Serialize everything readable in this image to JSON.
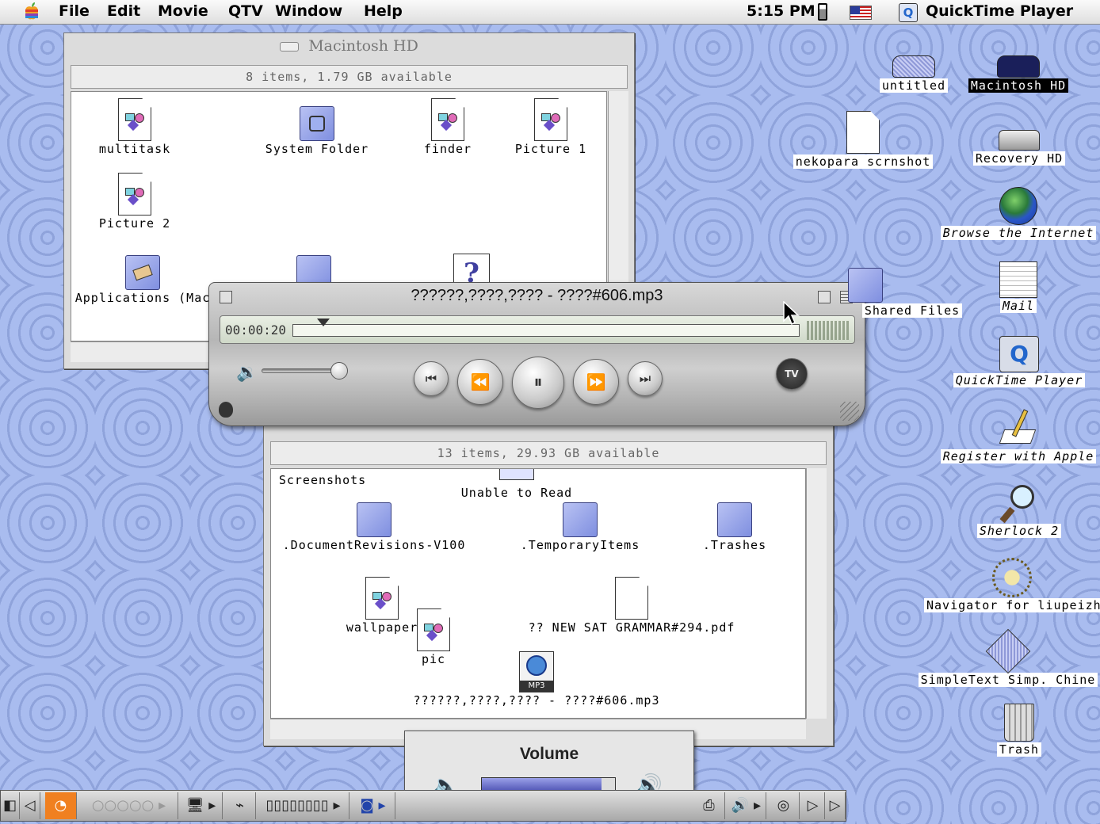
{
  "menubar": {
    "items": [
      "File",
      "Edit",
      "Movie",
      "QTV",
      "Window",
      "Help"
    ],
    "clock": "5:15 PM",
    "app_name": "QuickTime Player",
    "apple_icon": "apple-logo"
  },
  "macintosh_hd_window": {
    "title": "Macintosh HD",
    "info": "8 items, 1.79 GB available",
    "items": [
      {
        "label": "multitask",
        "icon": "picture-doc"
      },
      {
        "label": "System Folder",
        "icon": "system-folder"
      },
      {
        "label": "finder",
        "icon": "picture-doc"
      },
      {
        "label": "Picture 1",
        "icon": "picture-doc"
      },
      {
        "label": "Picture 2",
        "icon": "picture-doc"
      },
      {
        "label": "Applications (Mac",
        "icon": "applications-folder"
      }
    ]
  },
  "second_window": {
    "info": "13 items, 29.93 GB available",
    "items": [
      {
        "label": "Screenshots"
      },
      {
        "label": "Unable to Read"
      },
      {
        "label": ".DocumentRevisions-V100"
      },
      {
        "label": ".TemporaryItems"
      },
      {
        "label": ".Trashes"
      },
      {
        "label": "wallpaper"
      },
      {
        "label": "pic"
      },
      {
        "label": "?? NEW SAT GRAMMAR#294.pdf"
      },
      {
        "label": "??????,????,???? - ????#606.mp3"
      }
    ]
  },
  "quicktime_player": {
    "title": "??????,????,???? - ????#606.mp3",
    "time": "00:00:20",
    "playhead_fraction": 0.06,
    "volume_fraction": 1.0,
    "tv_label": "TV"
  },
  "volume_panel": {
    "title": "Volume",
    "level_fraction": 0.9
  },
  "desktop_icons": [
    {
      "label": "untitled",
      "selected": false,
      "italic": false
    },
    {
      "label": "Macintosh HD",
      "selected": true,
      "italic": false
    },
    {
      "label": "nekopara scrnshot",
      "selected": false,
      "italic": false
    },
    {
      "label": "Recovery HD",
      "selected": false,
      "italic": false
    },
    {
      "label": "Browse the Internet",
      "selected": false,
      "italic": true
    },
    {
      "label": "Shared Files",
      "selected": false,
      "italic": false
    },
    {
      "label": "Mail",
      "selected": false,
      "italic": true
    },
    {
      "label": "QuickTime Player",
      "selected": false,
      "italic": true
    },
    {
      "label": "Register with Apple",
      "selected": false,
      "italic": true
    },
    {
      "label": "Sherlock 2",
      "selected": false,
      "italic": true
    },
    {
      "label": "Navigator for liupeizh",
      "selected": false,
      "italic": false
    },
    {
      "label": "SimpleText Simp. Chine",
      "selected": false,
      "italic": false
    },
    {
      "label": "Trash",
      "selected": false,
      "italic": false
    }
  ]
}
